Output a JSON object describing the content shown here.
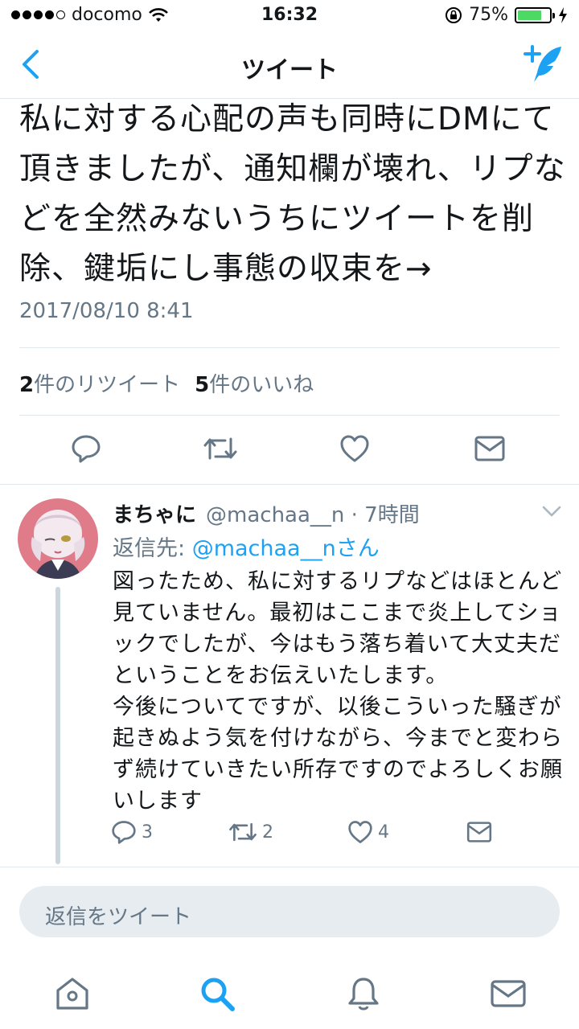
{
  "status_bar": {
    "carrier": "docomo",
    "time": "16:32",
    "battery_percent": "75%",
    "battery_level": 0.75
  },
  "nav": {
    "title": "ツイート"
  },
  "tweet": {
    "text": "私に対する心配の声も同時にDMにて頂きましたが、通知欄が壊れ、リプなどを全然みないうちにツイートを削除、鍵垢にし事態の収束を→",
    "timestamp": "2017/08/10 8:41",
    "retweet_count": "2",
    "retweet_label": "件のリツイート",
    "like_count": "5",
    "like_label": "件のいいね"
  },
  "reply": {
    "display_name": "まちゃに",
    "handle_time": "@machaa__n · 7時間",
    "reply_to_prefix": "返信先: ",
    "reply_to_mention": "@machaa__nさん",
    "text": "図ったため、私に対するリプなどはほとんど見ていません。最初はここまで炎上してショックでしたが、今はもう落ち着いて大丈夫だということをお伝えいたします。\n今後についてですが、以後こういった騒ぎが起きぬよう気を付けながら、今までと変わらず続けていきたい所存ですのでよろしくお願いします",
    "reply_count": "3",
    "retweet_count": "2",
    "like_count": "4"
  },
  "compose": {
    "placeholder": "返信をツイート"
  },
  "colors": {
    "accent": "#1da1f2",
    "secondary_text": "#657786",
    "divider": "#e1e8ed"
  }
}
